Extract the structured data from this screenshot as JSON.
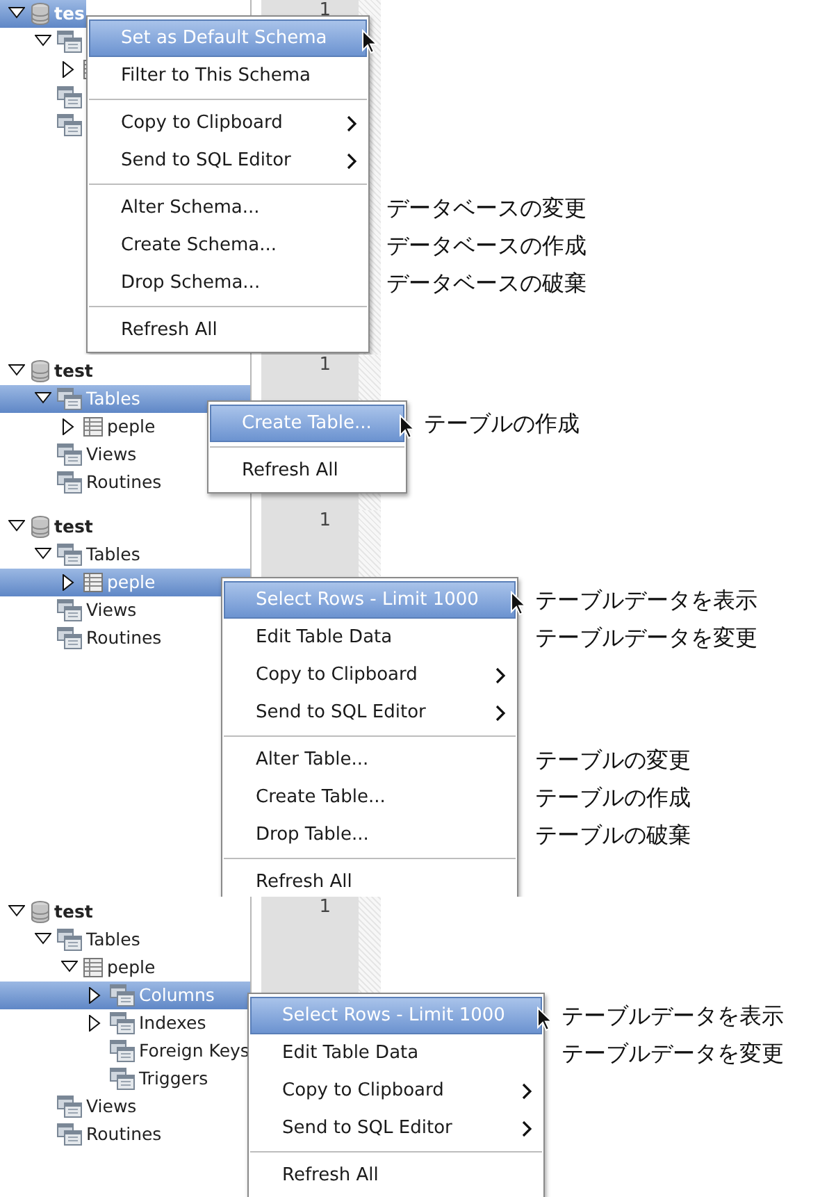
{
  "panels": [
    {
      "line_number": "1",
      "tree": [
        {
          "kind": "schema",
          "label": "tes",
          "expanded": true,
          "selected": true,
          "children": [
            {
              "kind": "group",
              "expanded": true,
              "selected": false,
              "children": [
                {
                  "kind": "table",
                  "expanded": false,
                  "selected": false
                }
              ]
            },
            {
              "kind": "group",
              "selected": false
            },
            {
              "kind": "group",
              "selected": false
            }
          ]
        }
      ],
      "menu": {
        "items": [
          {
            "kind": "item",
            "label": "Set as Default Schema",
            "selected": true,
            "submenu": false
          },
          {
            "kind": "item",
            "label": "Filter to This Schema",
            "selected": false,
            "submenu": false
          },
          {
            "kind": "separator"
          },
          {
            "kind": "item",
            "label": "Copy to Clipboard",
            "selected": false,
            "submenu": true
          },
          {
            "kind": "item",
            "label": "Send to SQL Editor",
            "selected": false,
            "submenu": true
          },
          {
            "kind": "separator"
          },
          {
            "kind": "item",
            "label": "Alter Schema...",
            "selected": false,
            "submenu": false,
            "note": "データベースの変更"
          },
          {
            "kind": "item",
            "label": "Create Schema...",
            "selected": false,
            "submenu": false,
            "note": "データベースの作成"
          },
          {
            "kind": "item",
            "label": "Drop Schema...",
            "selected": false,
            "submenu": false,
            "note": "データベースの破棄"
          },
          {
            "kind": "separator"
          },
          {
            "kind": "item",
            "label": "Refresh All",
            "selected": false,
            "submenu": false
          }
        ]
      }
    },
    {
      "line_number": "1",
      "tree": [
        {
          "kind": "schema",
          "label": "test",
          "expanded": true,
          "selected": false,
          "children": [
            {
              "kind": "group",
              "label": "Tables",
              "expanded": true,
              "selected": true,
              "children": [
                {
                  "kind": "table",
                  "label": "peple",
                  "expanded": false,
                  "selected": false
                }
              ]
            },
            {
              "kind": "group",
              "label": "Views",
              "selected": false
            },
            {
              "kind": "group",
              "label": "Routines",
              "selected": false
            }
          ]
        }
      ],
      "menu": {
        "items": [
          {
            "kind": "item",
            "label": "Create Table...",
            "selected": true,
            "submenu": false,
            "note": "テーブルの作成"
          },
          {
            "kind": "separator"
          },
          {
            "kind": "item",
            "label": "Refresh All",
            "selected": false,
            "submenu": false
          }
        ]
      }
    },
    {
      "line_number": "1",
      "tree": [
        {
          "kind": "schema",
          "label": "test",
          "expanded": true,
          "selected": false,
          "children": [
            {
              "kind": "group",
              "label": "Tables",
              "expanded": true,
              "selected": false,
              "children": [
                {
                  "kind": "table",
                  "label": "peple",
                  "expanded": false,
                  "selected": true
                }
              ]
            },
            {
              "kind": "group",
              "label": "Views",
              "selected": false
            },
            {
              "kind": "group",
              "label": "Routines",
              "selected": false
            }
          ]
        }
      ],
      "menu": {
        "items": [
          {
            "kind": "item",
            "label": "Select Rows - Limit 1000",
            "selected": true,
            "submenu": false,
            "note": "テーブルデータを表示"
          },
          {
            "kind": "item",
            "label": "Edit Table Data",
            "selected": false,
            "submenu": false,
            "note": "テーブルデータを変更"
          },
          {
            "kind": "item",
            "label": "Copy to Clipboard",
            "selected": false,
            "submenu": true
          },
          {
            "kind": "item",
            "label": "Send to SQL Editor",
            "selected": false,
            "submenu": true
          },
          {
            "kind": "separator"
          },
          {
            "kind": "item",
            "label": "Alter Table...",
            "selected": false,
            "submenu": false,
            "note": "テーブルの変更"
          },
          {
            "kind": "item",
            "label": "Create Table...",
            "selected": false,
            "submenu": false,
            "note": "テーブルの作成"
          },
          {
            "kind": "item",
            "label": "Drop Table...",
            "selected": false,
            "submenu": false,
            "note": "テーブルの破棄"
          },
          {
            "kind": "separator"
          },
          {
            "kind": "item",
            "label": "Refresh All",
            "selected": false,
            "submenu": false
          }
        ]
      }
    },
    {
      "line_number": "1",
      "tree": [
        {
          "kind": "schema",
          "label": "test",
          "expanded": true,
          "selected": false,
          "children": [
            {
              "kind": "group",
              "label": "Tables",
              "expanded": true,
              "selected": false,
              "children": [
                {
                  "kind": "table",
                  "label": "peple",
                  "expanded": true,
                  "selected": false,
                  "children": [
                    {
                      "kind": "group",
                      "label": "Columns",
                      "expanded": false,
                      "selected": true
                    },
                    {
                      "kind": "group",
                      "label": "Indexes",
                      "expanded": false,
                      "selected": false
                    },
                    {
                      "kind": "group",
                      "label": "Foreign Keys",
                      "selected": false
                    },
                    {
                      "kind": "group",
                      "label": "Triggers",
                      "selected": false
                    }
                  ]
                }
              ]
            },
            {
              "kind": "group",
              "label": "Views",
              "selected": false
            },
            {
              "kind": "group",
              "label": "Routines",
              "selected": false
            }
          ]
        }
      ],
      "menu": {
        "items": [
          {
            "kind": "item",
            "label": "Select Rows - Limit 1000",
            "selected": true,
            "submenu": false,
            "note": "テーブルデータを表示"
          },
          {
            "kind": "item",
            "label": "Edit Table Data",
            "selected": false,
            "submenu": false,
            "note": "テーブルデータを変更"
          },
          {
            "kind": "item",
            "label": "Copy to Clipboard",
            "selected": false,
            "submenu": true
          },
          {
            "kind": "item",
            "label": "Send to SQL Editor",
            "selected": false,
            "submenu": true
          },
          {
            "kind": "separator"
          },
          {
            "kind": "item",
            "label": "Refresh All",
            "selected": false,
            "submenu": false
          }
        ]
      }
    }
  ]
}
